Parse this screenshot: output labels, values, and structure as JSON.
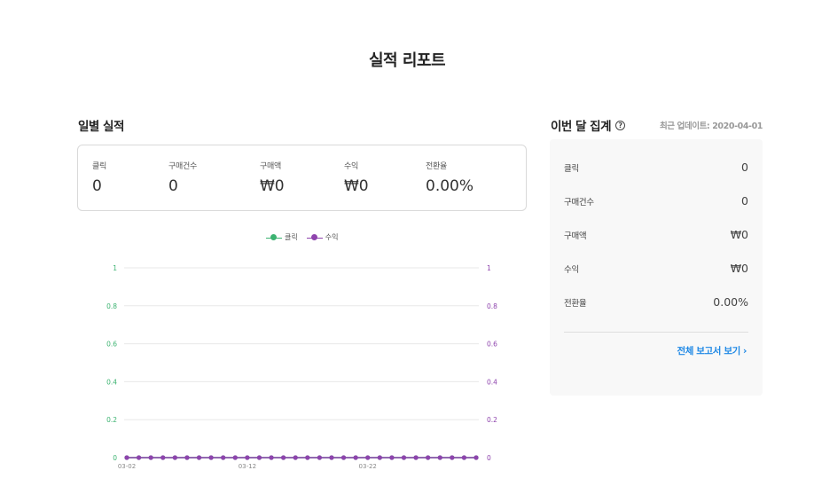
{
  "page": {
    "title": "실적 리포트"
  },
  "daily": {
    "title": "일별 실적",
    "stats": [
      {
        "label": "클릭",
        "value": "0"
      },
      {
        "label": "구매건수",
        "value": "0"
      },
      {
        "label": "구매액",
        "value": "₩0"
      },
      {
        "label": "수익",
        "value": "₩0"
      },
      {
        "label": "전환율",
        "value": "0.00%"
      }
    ]
  },
  "legend": {
    "clicks": "클릭",
    "revenue": "수익"
  },
  "chart_data": {
    "type": "line",
    "x": [
      "03-02",
      "03-03",
      "03-04",
      "03-05",
      "03-06",
      "03-07",
      "03-08",
      "03-09",
      "03-10",
      "03-11",
      "03-12",
      "03-13",
      "03-14",
      "03-15",
      "03-16",
      "03-17",
      "03-18",
      "03-19",
      "03-20",
      "03-21",
      "03-22",
      "03-23",
      "03-24",
      "03-25",
      "03-26",
      "03-27",
      "03-28",
      "03-29",
      "03-30",
      "03-31"
    ],
    "xtick_labels": [
      "03-02",
      "03-12",
      "03-22"
    ],
    "series": [
      {
        "name": "클릭",
        "axis": "left",
        "color": "#3cb371",
        "values": [
          0,
          0,
          0,
          0,
          0,
          0,
          0,
          0,
          0,
          0,
          0,
          0,
          0,
          0,
          0,
          0,
          0,
          0,
          0,
          0,
          0,
          0,
          0,
          0,
          0,
          0,
          0,
          0,
          0,
          0
        ]
      },
      {
        "name": "수익",
        "axis": "right",
        "color": "#8e44ad",
        "values": [
          0,
          0,
          0,
          0,
          0,
          0,
          0,
          0,
          0,
          0,
          0,
          0,
          0,
          0,
          0,
          0,
          0,
          0,
          0,
          0,
          0,
          0,
          0,
          0,
          0,
          0,
          0,
          0,
          0,
          0
        ]
      }
    ],
    "ylim": [
      0,
      1
    ],
    "yticks": [
      "0",
      "0.2",
      "0.4",
      "0.6",
      "0.8",
      "1"
    ],
    "grid": true,
    "legend_position": "top"
  },
  "monthly": {
    "title": "이번 달 집계",
    "help_icon": "help-circle-icon",
    "updated": "최근 업데이트: 2020-04-01",
    "rows": [
      {
        "label": "클릭",
        "value": "0"
      },
      {
        "label": "구매건수",
        "value": "0"
      },
      {
        "label": "구매액",
        "value": "₩0"
      },
      {
        "label": "수익",
        "value": "₩0"
      },
      {
        "label": "전환율",
        "value": "0.00%"
      }
    ],
    "link": "전체 보고서 보기",
    "link_icon": "chevron-right-icon"
  }
}
